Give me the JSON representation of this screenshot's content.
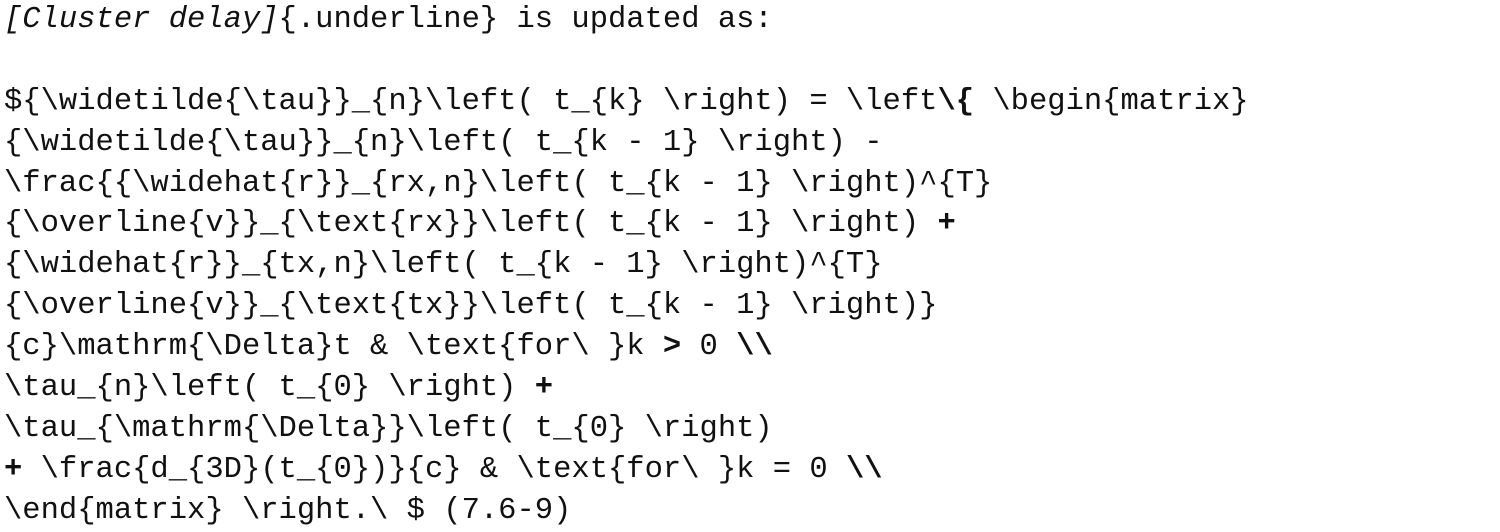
{
  "lines": [
    [
      {
        "t": "[Cluster delay]",
        "s": "it"
      },
      {
        "t": "{.underline} is updated as:",
        "s": ""
      }
    ],
    [],
    [
      {
        "t": "${\\widetilde{\\tau}}_{n}\\left( t_{k} \\right) = \\left",
        "s": ""
      },
      {
        "t": "\\{",
        "s": "b"
      },
      {
        "t": " \\begin{matrix}",
        "s": ""
      }
    ],
    [
      {
        "t": "{\\widetilde{\\tau}}_{n}\\left( t_{k - 1} \\right) -",
        "s": ""
      }
    ],
    [
      {
        "t": "\\frac{{\\widehat{r}}_{rx,n}\\left( t_{k - 1} \\right)^{T}",
        "s": ""
      }
    ],
    [
      {
        "t": "{\\overline{v}}_{\\text{rx}}\\left( t_{k - 1} \\right) ",
        "s": ""
      },
      {
        "t": "+",
        "s": "b"
      }
    ],
    [
      {
        "t": "{\\widehat{r}}_{tx,n}\\left( t_{k - 1} \\right)^{T}",
        "s": ""
      }
    ],
    [
      {
        "t": "{\\overline{v}}_{\\text{tx}}\\left( t_{k - 1} \\right)}",
        "s": ""
      }
    ],
    [
      {
        "t": "{c}\\mathrm{\\Delta}t & \\text{for\\ }k ",
        "s": ""
      },
      {
        "t": ">",
        "s": "b"
      },
      {
        "t": " 0 ",
        "s": ""
      },
      {
        "t": "\\\\",
        "s": "b"
      }
    ],
    [
      {
        "t": "\\tau_{n}\\left( t_{0} \\right) ",
        "s": ""
      },
      {
        "t": "+",
        "s": "b"
      }
    ],
    [
      {
        "t": "\\tau_{\\mathrm{\\Delta}}\\left( t_{0} \\right)",
        "s": ""
      }
    ],
    [
      {
        "t": "+",
        "s": "b"
      },
      {
        "t": " \\frac{d_{3D}(t_{0})}{c} & \\text{for\\ }k = 0 ",
        "s": ""
      },
      {
        "t": "\\\\",
        "s": "b"
      }
    ],
    [
      {
        "t": "\\end{matrix} \\right.\\ $ (7.6-9)",
        "s": ""
      }
    ]
  ]
}
